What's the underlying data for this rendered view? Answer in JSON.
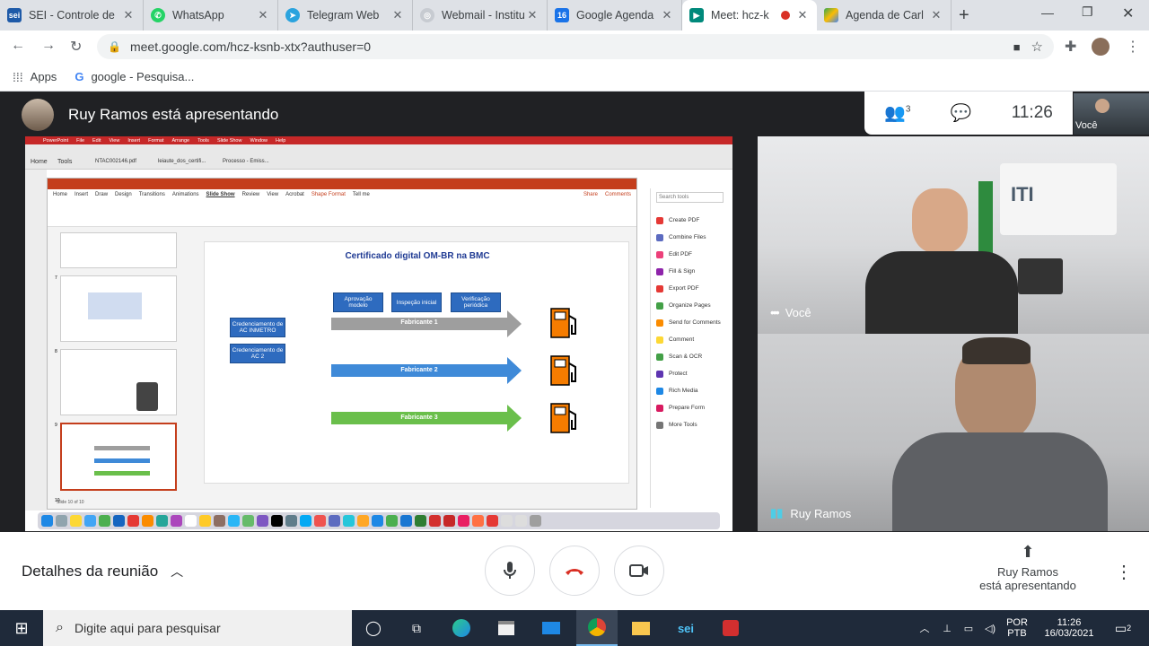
{
  "tabs": [
    {
      "label": "SEI - Controle de",
      "fav": "sei",
      "color": "#1e5aa8"
    },
    {
      "label": "WhatsApp",
      "fav": "whatsapp",
      "color": "#25d366"
    },
    {
      "label": "Telegram Web",
      "fav": "telegram",
      "color": "#2aa3de"
    },
    {
      "label": "Webmail - Institu",
      "fav": "webmail",
      "color": "#9aa0a6"
    },
    {
      "label": "Google Agenda",
      "fav": "calendar",
      "color": "#1a73e8"
    },
    {
      "label": "Meet: hcz-k",
      "fav": "meet",
      "color": "#00897b"
    },
    {
      "label": "Agenda de Carl",
      "fav": "drive",
      "color": "#f4b400"
    }
  ],
  "address": {
    "url": "meet.google.com/hcz-ksnb-xtx?authuser=0"
  },
  "bookmarks": {
    "apps": "Apps",
    "google": "google - Pesquisa..."
  },
  "meet": {
    "presenter_banner": "Ruy Ramos está apresentando",
    "participants_count": "3",
    "clock": "11:26",
    "self_thumb_label": "Você",
    "tile_you": "Você",
    "tile_ruy": "Ruy Ramos",
    "meeting_details": "Detalhes da reunião",
    "presenting_line1": "Ruy Ramos",
    "presenting_line2": "está apresentando"
  },
  "slide": {
    "title": "Certificado digital OM-BR na BMC",
    "cred1": "Credenciamento de AC INMETRO",
    "cred2": "Credenciamento de AC 2",
    "step1": "Aprovação modelo",
    "step2": "Inspeção inicial",
    "step3": "Verificação periódica",
    "fab1": "Fabricante 1",
    "fab2": "Fabricante 2",
    "fab3": "Fabricante 3",
    "slide_nums": [
      "7",
      "8",
      "9",
      "10"
    ]
  },
  "ppt": {
    "menu": [
      "Home",
      "Insert",
      "Draw",
      "Design",
      "Transitions",
      "Animations",
      "Slide Show",
      "Review",
      "View",
      "Acrobat",
      "Shape Format",
      "Tell me"
    ],
    "share": "Share",
    "comments": "Comments",
    "mac_menu": [
      "PowerPoint",
      "File",
      "Edit",
      "View",
      "Insert",
      "Format",
      "Arrange",
      "Tools",
      "Slide Show",
      "Window",
      "Help"
    ],
    "pdf_tabs": [
      "Home",
      "Tools"
    ],
    "pdf_files": [
      "NTAC002146.pdf",
      "leiaute_dos_certifi...",
      "Processo - Emiss..."
    ],
    "search_tools": "Search tools",
    "tools": [
      "Create PDF",
      "Combine Files",
      "Edit PDF",
      "Fill & Sign",
      "Export PDF",
      "Organize Pages",
      "Send for Comments",
      "Comment",
      "Scan & OCR",
      "Protect",
      "Rich Media",
      "Prepare Form",
      "More Tools"
    ],
    "status": "Slide 10 of 10"
  },
  "taskbar": {
    "search": "Digite aqui para pesquisar",
    "lang1": "POR",
    "lang2": "PTB",
    "time": "11:26",
    "date": "16/03/2021",
    "notif": "2"
  }
}
